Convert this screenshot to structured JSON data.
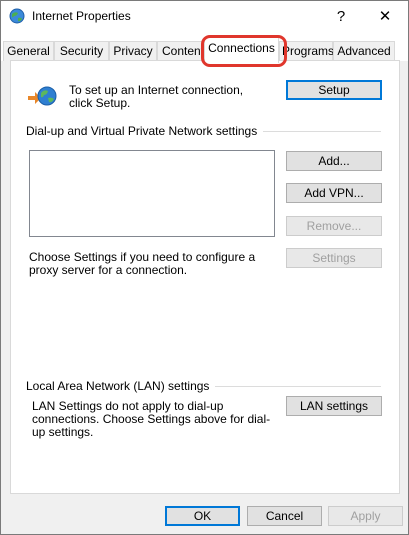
{
  "window": {
    "title": "Internet Properties",
    "help_glyph": "?",
    "close_glyph": "✕"
  },
  "tabs": [
    {
      "label": "General"
    },
    {
      "label": "Security"
    },
    {
      "label": "Privacy"
    },
    {
      "label": "Content"
    },
    {
      "label": "Connections",
      "active": true
    },
    {
      "label": "Programs"
    },
    {
      "label": "Advanced"
    }
  ],
  "connections": {
    "intro": "To set up an Internet connection, click Setup.",
    "setup_label": "Setup",
    "dialup_group_label": "Dial-up and Virtual Private Network settings",
    "add_label": "Add...",
    "add_vpn_label": "Add VPN...",
    "remove_label": "Remove...",
    "settings_label": "Settings",
    "proxy_text": "Choose Settings if you need to configure a proxy server for a connection.",
    "lan_group_label": "Local Area Network (LAN) settings",
    "lan_text": "LAN Settings do not apply to dial-up connections. Choose Settings above for dial-up settings.",
    "lan_settings_label": "LAN settings"
  },
  "footer": {
    "ok_label": "OK",
    "cancel_label": "Cancel",
    "apply_label": "Apply"
  },
  "colors": {
    "highlight": "#e0362c",
    "default_button_border": "#0078d7"
  },
  "icons": {
    "title": "internet-globe-icon",
    "connection": "globe-connection-icon"
  }
}
